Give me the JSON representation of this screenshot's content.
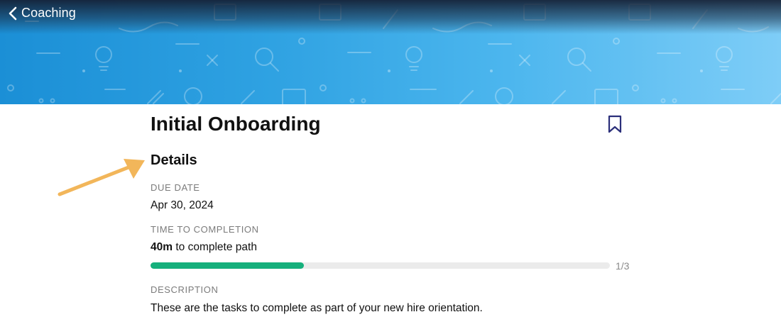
{
  "header": {
    "back_label": "Coaching"
  },
  "path": {
    "title": "Initial Onboarding",
    "bookmarked": false
  },
  "details": {
    "heading": "Details",
    "due_date_label": "DUE DATE",
    "due_date_value": "Apr 30, 2024",
    "time_label": "TIME TO COMPLETION",
    "time_value_bold": "40m",
    "time_value_rest": " to complete path",
    "progress": {
      "completed": 1,
      "total": 3,
      "text": "1/3"
    },
    "description_label": "DESCRIPTION",
    "description_value": "These are the tasks to complete as part of your new hire orientation."
  },
  "colors": {
    "accent_progress": "#16b07c",
    "banner_blue": "#2fa2e2",
    "bookmark_icon": "#2b2f7a",
    "annotation_arrow": "#f2b65a"
  },
  "icons": {
    "back": "chevron-left-icon",
    "bookmark": "bookmark-icon"
  }
}
